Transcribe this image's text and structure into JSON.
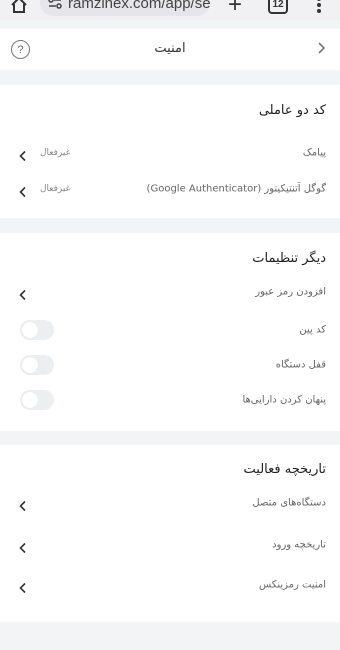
{
  "browser": {
    "url": "ramzinex.com/app/sec",
    "tab_count": "12"
  },
  "header": {
    "title": "امنیت",
    "help_glyph": "?"
  },
  "two_factor": {
    "title": "کد دو عاملی",
    "items": [
      {
        "label": "پیامک",
        "status": "غیرفعال"
      },
      {
        "label": "گوگل آتنتیکیتور (Google Authenticator)",
        "status": "غیرفعال"
      }
    ]
  },
  "other_settings": {
    "title": "دیگر تنظیمات",
    "add_password": {
      "label": "افزودن رمز عبور"
    },
    "toggles": [
      {
        "label": "کد پین",
        "on": false
      },
      {
        "label": "قفل دستگاه",
        "on": false
      },
      {
        "label": "پنهان کردن دارایی‌ها",
        "on": false
      }
    ]
  },
  "activity": {
    "title": "تاریخچه فعالیت",
    "items": [
      {
        "label": "دستگاه‌های متصل"
      },
      {
        "label": "تاریخچه ورود"
      },
      {
        "label": "امنیت رمزینکس"
      }
    ]
  },
  "colors": {
    "background": "#f3f4f6",
    "card": "#ffffff",
    "toggle_off": "#eceef0"
  }
}
